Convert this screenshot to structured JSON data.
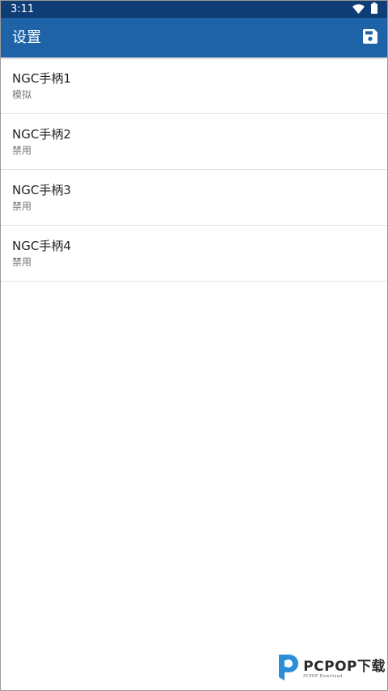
{
  "status_bar": {
    "time": "3:11",
    "icons": [
      "wifi-icon",
      "battery-icon"
    ],
    "background": "#0f3d75"
  },
  "app_bar": {
    "title": "设置",
    "action_icon": "save-icon",
    "background": "#1e63a8"
  },
  "settings_list": [
    {
      "title": "NGC手柄1",
      "subtitle": "模拟"
    },
    {
      "title": "NGC手柄2",
      "subtitle": "禁用"
    },
    {
      "title": "NGC手柄3",
      "subtitle": "禁用"
    },
    {
      "title": "NGC手柄4",
      "subtitle": "禁用"
    }
  ],
  "watermark": {
    "text": "PCPOP下载",
    "subtext": "PCPOP Download",
    "accent": "#2a8fd8"
  }
}
